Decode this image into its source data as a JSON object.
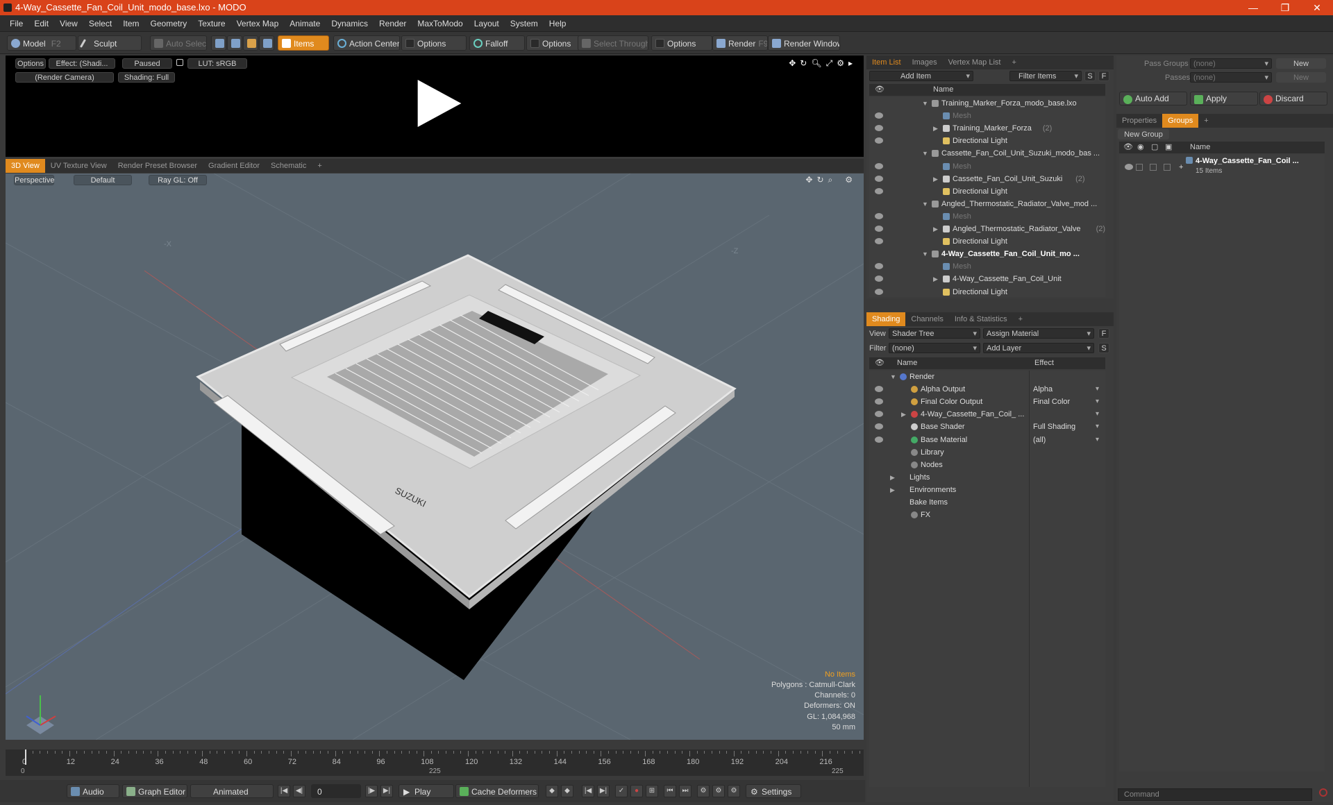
{
  "window": {
    "title": "4-Way_Cassette_Fan_Coil_Unit_modo_base.lxo - MODO",
    "minimize": "—",
    "maximize": "❐",
    "close": "✕"
  },
  "menu": [
    "File",
    "Edit",
    "View",
    "Select",
    "Item",
    "Geometry",
    "Texture",
    "Vertex Map",
    "Animate",
    "Dynamics",
    "Render",
    "MaxToModo",
    "Layout",
    "System",
    "Help"
  ],
  "toolbar": {
    "model": "Model",
    "model_key": "F2",
    "sculpt": "Sculpt",
    "auto_select": "Auto Select",
    "items": "Items",
    "action_center": "Action Center",
    "options1": "Options",
    "falloff": "Falloff",
    "options2": "Options",
    "select_through": "Select Through",
    "options3": "Options",
    "render": "Render",
    "render_key": "F9",
    "render_window": "Render Window"
  },
  "preview": {
    "options": "Options",
    "effect": "Effect: (Shadi...",
    "paused": "Paused",
    "lut": "LUT: sRGB",
    "camera": "(Render Camera)",
    "shading": "Shading: Full"
  },
  "viewtabs": [
    "3D View",
    "UV Texture View",
    "Render Preset Browser",
    "Gradient Editor",
    "Schematic",
    "+"
  ],
  "viewport": {
    "perspective": "Perspective",
    "default": "Default",
    "raygl": "Ray GL: Off",
    "brand": "SUZUKI",
    "axis_x": "-X",
    "axis_z": "-Z"
  },
  "stats": {
    "items": "No Items",
    "polygons": "Polygons : Catmull-Clark",
    "channels": "Channels: 0",
    "deformers": "Deformers: ON",
    "gl": "GL: 1,084,968",
    "focal": "50 mm"
  },
  "timeline": {
    "ticks": [
      "0",
      "12",
      "24",
      "36",
      "48",
      "60",
      "72",
      "84",
      "96",
      "108",
      "120",
      "132",
      "144",
      "156",
      "168",
      "180",
      "192",
      "204",
      "216"
    ],
    "start": "0",
    "mid": "225",
    "end": "225"
  },
  "bottom": {
    "audio": "Audio",
    "graph_editor": "Graph Editor",
    "animated": "Animated",
    "frame": "0",
    "play": "Play",
    "cache": "Cache Deformers",
    "settings": "Settings"
  },
  "itemlist": {
    "tabs": [
      "Item List",
      "Images",
      "Vertex Map List",
      "+"
    ],
    "add_item": "Add Item",
    "filter": "Filter Items",
    "s": "S",
    "f": "F",
    "col_name": "Name",
    "rows": [
      {
        "label": "Training_Marker_Forza_modo_base.lxo",
        "indent": 1,
        "arrow": "▼",
        "kind": "scene"
      },
      {
        "label": "Mesh",
        "indent": 3,
        "kind": "mesh"
      },
      {
        "label": "Training_Marker_Forza",
        "count": "(2)",
        "indent": 3,
        "arrow": "▶",
        "kind": "group"
      },
      {
        "label": "Directional Light",
        "indent": 3,
        "kind": "light"
      },
      {
        "label": "Cassette_Fan_Coil_Unit_Suzuki_modo_bas ...",
        "indent": 1,
        "arrow": "▼",
        "kind": "scene"
      },
      {
        "label": "Mesh",
        "indent": 3,
        "kind": "mesh"
      },
      {
        "label": "Cassette_Fan_Coil_Unit_Suzuki",
        "count": "(2)",
        "indent": 3,
        "arrow": "▶",
        "kind": "group"
      },
      {
        "label": "Directional Light",
        "indent": 3,
        "kind": "light"
      },
      {
        "label": "Angled_Thermostatic_Radiator_Valve_mod ...",
        "indent": 1,
        "arrow": "▼",
        "kind": "scene"
      },
      {
        "label": "Mesh",
        "indent": 3,
        "kind": "mesh"
      },
      {
        "label": "Angled_Thermostatic_Radiator_Valve",
        "count": "(2)",
        "indent": 3,
        "arrow": "▶",
        "kind": "group"
      },
      {
        "label": "Directional Light",
        "indent": 3,
        "kind": "light"
      },
      {
        "label": "4-Way_Cassette_Fan_Coil_Unit_mo ...",
        "indent": 1,
        "arrow": "▼",
        "kind": "scene",
        "bold": true
      },
      {
        "label": "Mesh",
        "indent": 3,
        "kind": "mesh"
      },
      {
        "label": "4-Way_Cassette_Fan_Coil_Unit",
        "indent": 3,
        "arrow": "▶",
        "kind": "group"
      },
      {
        "label": "Directional Light",
        "indent": 3,
        "kind": "light"
      }
    ]
  },
  "shading": {
    "tabs": [
      "Shading",
      "Channels",
      "Info & Statistics",
      "+"
    ],
    "view_label": "View",
    "view": "Shader Tree",
    "assign": "Assign Material",
    "f": "F",
    "filter_label": "Filter",
    "filter": "(none)",
    "add_layer": "Add Layer",
    "s": "S",
    "col_name": "Name",
    "col_effect": "Effect",
    "rows": [
      {
        "label": "Render",
        "effect": "",
        "indent": 0,
        "arrow": "▼",
        "color": "#5577cc"
      },
      {
        "label": "Alpha Output",
        "effect": "Alpha",
        "indent": 1,
        "color": "#d0a040"
      },
      {
        "label": "Final Color Output",
        "effect": "Final Color",
        "indent": 1,
        "color": "#d0a040"
      },
      {
        "label": "4-Way_Cassette_Fan_Coil_ ...",
        "effect": "",
        "indent": 1,
        "arrow": "▶",
        "color": "#cc4444"
      },
      {
        "label": "Base Shader",
        "effect": "Full Shading",
        "indent": 1,
        "color": "#cccccc"
      },
      {
        "label": "Base Material",
        "effect": "(all)",
        "indent": 1,
        "color": "#44aa66"
      },
      {
        "label": "Library",
        "effect": "",
        "indent": 1,
        "color": "#888888"
      },
      {
        "label": "Nodes",
        "effect": "",
        "indent": 1,
        "color": "#888888"
      },
      {
        "label": "Lights",
        "effect": "",
        "indent": 0,
        "arrow": "▶",
        "color": ""
      },
      {
        "label": "Environments",
        "effect": "",
        "indent": 0,
        "arrow": "▶",
        "color": ""
      },
      {
        "label": "Bake Items",
        "effect": "",
        "indent": 0,
        "color": ""
      },
      {
        "label": "FX",
        "effect": "",
        "indent": 1,
        "color": "#888888"
      }
    ]
  },
  "groups": {
    "pass_groups_label": "Pass Groups",
    "pass_groups": "(none)",
    "new1": "New",
    "passes_label": "Passes",
    "passes": "(none)",
    "new2": "New",
    "auto_add": "Auto Add",
    "apply": "Apply",
    "discard": "Discard",
    "tabs": [
      "Properties",
      "Groups",
      "+"
    ],
    "new_group": "New Group",
    "col_name": "Name",
    "group_name": "4-Way_Cassette_Fan_Coil ...",
    "group_items": "15 Items"
  },
  "command": {
    "placeholder": "Command"
  }
}
